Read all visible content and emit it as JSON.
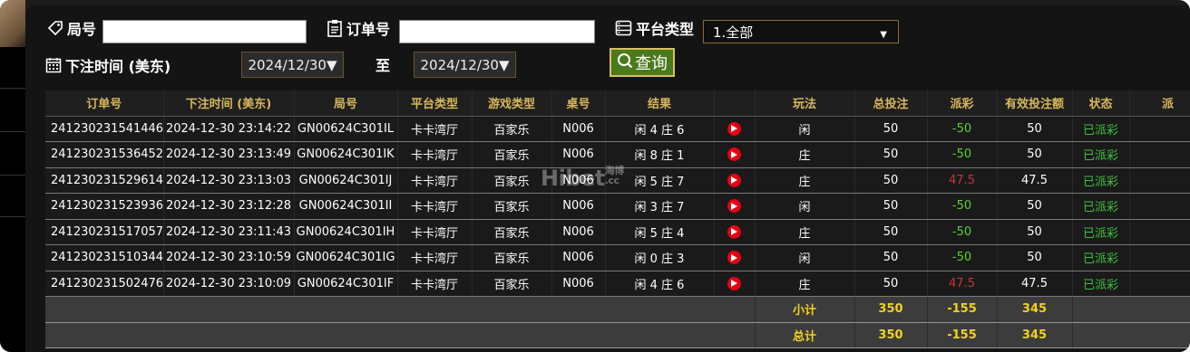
{
  "filters": {
    "round_label": "局号",
    "round_value": "",
    "order_label": "订单号",
    "order_value": "",
    "platform_label": "平台类型",
    "platform_selected": "1.全部",
    "time_label": "下注时间 (美东)",
    "date_from": "2024/12/30▼",
    "to_label": "至",
    "date_to": "2024/12/30▼",
    "query_label": "查询"
  },
  "table": {
    "headers": [
      "订单号",
      "下注时间 (美东)",
      "局号",
      "平台类型",
      "游戏类型",
      "桌号",
      "结果",
      "",
      "玩法",
      "总投注",
      "派彩",
      "有效投注额",
      "状态",
      "派"
    ],
    "rows": [
      {
        "order": "241230231541446",
        "time": "2024-12-30 23:14:22",
        "round": "GN00624C301IL",
        "platform": "卡卡湾厅",
        "game": "百家乐",
        "table": "N006",
        "result": "闲 4 庄 6",
        "play": "闲",
        "bet": "50",
        "payout": "-50",
        "payout_class": "win",
        "valid": "50",
        "status": "已派彩"
      },
      {
        "order": "241230231536452",
        "time": "2024-12-30 23:13:49",
        "round": "GN00624C301IK",
        "platform": "卡卡湾厅",
        "game": "百家乐",
        "table": "N006",
        "result": "闲 8 庄 1",
        "play": "庄",
        "bet": "50",
        "payout": "-50",
        "payout_class": "win",
        "valid": "50",
        "status": "已派彩"
      },
      {
        "order": "241230231529614",
        "time": "2024-12-30 23:13:03",
        "round": "GN00624C301IJ",
        "platform": "卡卡湾厅",
        "game": "百家乐",
        "table": "N006",
        "result": "闲 5 庄 7",
        "play": "庄",
        "bet": "50",
        "payout": "47.5",
        "payout_class": "lose",
        "valid": "47.5",
        "status": "已派彩"
      },
      {
        "order": "241230231523936",
        "time": "2024-12-30 23:12:28",
        "round": "GN00624C301II",
        "platform": "卡卡湾厅",
        "game": "百家乐",
        "table": "N006",
        "result": "闲 3 庄 7",
        "play": "闲",
        "bet": "50",
        "payout": "-50",
        "payout_class": "win",
        "valid": "50",
        "status": "已派彩"
      },
      {
        "order": "241230231517057",
        "time": "2024-12-30 23:11:43",
        "round": "GN00624C301IH",
        "platform": "卡卡湾厅",
        "game": "百家乐",
        "table": "N006",
        "result": "闲 5 庄 4",
        "play": "庄",
        "bet": "50",
        "payout": "-50",
        "payout_class": "win",
        "valid": "50",
        "status": "已派彩"
      },
      {
        "order": "241230231510344",
        "time": "2024-12-30 23:10:59",
        "round": "GN00624C301IG",
        "platform": "卡卡湾厅",
        "game": "百家乐",
        "table": "N006",
        "result": "闲 0 庄 3",
        "play": "闲",
        "bet": "50",
        "payout": "-50",
        "payout_class": "win",
        "valid": "50",
        "status": "已派彩"
      },
      {
        "order": "241230231502476",
        "time": "2024-12-30 23:10:09",
        "round": "GN00624C301IF",
        "platform": "卡卡湾厅",
        "game": "百家乐",
        "table": "N006",
        "result": "闲 4 庄 6",
        "play": "庄",
        "bet": "50",
        "payout": "47.5",
        "payout_class": "lose",
        "valid": "47.5",
        "status": "已派彩"
      }
    ],
    "subtotal": {
      "label": "小计",
      "bet": "350",
      "payout": "-155",
      "valid": "345"
    },
    "total": {
      "label": "总计",
      "bet": "350",
      "payout": "-155",
      "valid": "345"
    }
  },
  "watermark": {
    "main": "Hibet",
    "suffix_top": "海博",
    "suffix_bottom": ".cc"
  },
  "colors": {
    "header_text": "#d8b85a",
    "win_text": "#5bd12a",
    "lose_text": "#c8323a",
    "status_text": "#3fc13f",
    "total_text": "#f2d21e",
    "play_icon": "#e60012"
  }
}
